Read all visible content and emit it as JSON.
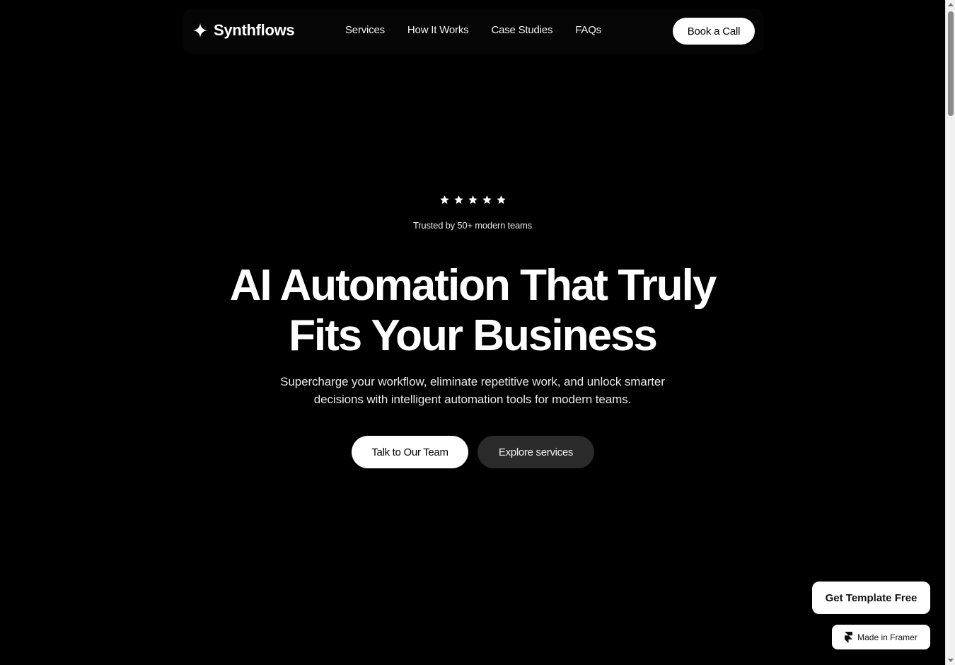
{
  "nav": {
    "brand": "Synthflows",
    "brand_icon": "sparkle-icon",
    "links": [
      "Services",
      "How It Works",
      "Case Studies",
      "FAQs"
    ],
    "book_label": "Book a Call"
  },
  "hero": {
    "rating": 5,
    "rating_icon": "star-icon",
    "trusted": "Trusted by 50+ modern teams",
    "title_line1": "AI Automation That Truly",
    "title_line2": "Fits Your Business",
    "subtitle_line1": "Supercharge your workflow, eliminate repetitive work, and unlock smarter",
    "subtitle_line2": "decisions with intelligent automation tools for modern teams.",
    "cta_primary": "Talk to Our Team",
    "cta_secondary": "Explore services"
  },
  "badges": {
    "template_label": "Get Template Free",
    "framer_label": "Made in Framer",
    "framer_icon": "framer-logo-icon"
  },
  "colors": {
    "background": "#000000",
    "text": "#ffffff",
    "button_primary": "#ffffff",
    "button_secondary": "#2b2b2b"
  }
}
